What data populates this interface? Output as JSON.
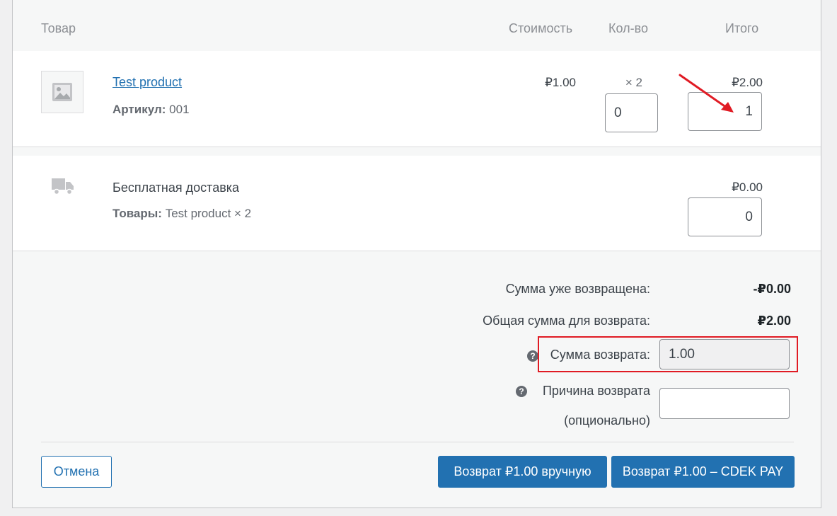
{
  "header": {
    "col_product": "Товар",
    "col_cost": "Стоимость",
    "col_qty": "Кол-во",
    "col_total": "Итого"
  },
  "item": {
    "name": "Test product",
    "sku_label": "Артикул:",
    "sku_value": "001",
    "cost": "₽1.00",
    "qty": "× 2",
    "total": "₽2.00",
    "refund_qty": "0",
    "refund_total": "1"
  },
  "shipping": {
    "name": "Бесплатная доставка",
    "items_label": "Товары:",
    "items_value": "Test product × 2",
    "total": "₽0.00",
    "refund_total": "0"
  },
  "totals": {
    "already_refunded_label": "Сумма уже возвращена:",
    "already_refunded_value": "-₽0.00",
    "available_label": "Общая сумма для возврата:",
    "available_value": "₽2.00",
    "refund_amount_label": "Сумма возврата:",
    "refund_amount_value": "1.00",
    "reason_label_line1": "Причина возврата",
    "reason_label_line2": "(опционально)",
    "reason_value": ""
  },
  "actions": {
    "cancel": "Отмена",
    "refund_manual": "Возврат ₽1.00 вручную",
    "refund_gateway": "Возврат ₽1.00 – CDEK PAY"
  },
  "colors": {
    "primary": "#2271b1",
    "highlight": "#e01b24",
    "arrow": "#e01b24"
  },
  "icons": {
    "thumb": "image-placeholder-icon",
    "shipping": "truck-icon",
    "help": "help-icon",
    "arrow": "arrow-annotation-icon"
  }
}
